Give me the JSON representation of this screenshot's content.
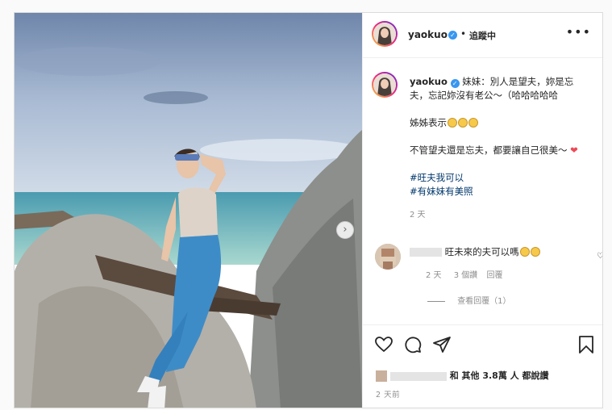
{
  "post": {
    "username": "yaokuo",
    "dot": "•",
    "follow_status": "追蹤中",
    "more_icon": "ellipsis-icon"
  },
  "caption": {
    "username": "yaokuo",
    "line1": "妹妹：別人是望夫，妳是忘夫，忘記妳沒有老公～（哈哈哈哈哈",
    "line2": "姊姊表示",
    "line3": "不管望夫還是忘夫，都要讓自己很美～",
    "hashtags": [
      "#旺夫我可以",
      "#有妹妹有美照"
    ],
    "time": "2 天"
  },
  "comment": {
    "text": "旺未來的夫可以嗎",
    "time": "2 天",
    "likes": "3 個讚",
    "reply": "回覆",
    "view_replies": "查看回覆（1）"
  },
  "footer": {
    "likes_text": "和 其他 3.8萬 人 都說讚",
    "posted_time": "2 天前"
  },
  "colors": {
    "link": "#00376b",
    "verified": "#3897f0",
    "heart": "#ed4956"
  }
}
